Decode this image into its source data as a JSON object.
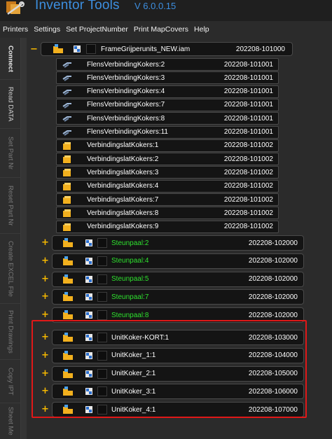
{
  "app": {
    "title": "Inventor Tools",
    "version": "V 6.0.0.15"
  },
  "menu": [
    "Printers",
    "Settings",
    "Set ProjectNumber",
    "Print MapCovers",
    "Help"
  ],
  "sidenav": [
    {
      "label": "Connect",
      "state": "active"
    },
    {
      "label": "Read DATA",
      "state": "mid"
    },
    {
      "label": "Set Part Nr",
      "state": "dim"
    },
    {
      "label": "Reset Part Nr",
      "state": "dim"
    },
    {
      "label": "Create EXCEL File",
      "state": "dim"
    },
    {
      "label": "Print Drawings",
      "state": "dim"
    },
    {
      "label": "Copy IPT",
      "state": "dim"
    },
    {
      "label": "Sheet Me",
      "state": "dim"
    }
  ],
  "tree": {
    "root": {
      "expander": "−",
      "label": "FrameGrijperunits_NEW.iam",
      "number": "202208-101000"
    },
    "children": [
      {
        "type": "flange",
        "label": "FlensVerbindingKokers:2",
        "number": "202208-101001"
      },
      {
        "type": "flange",
        "label": "FlensVerbindingKokers:3",
        "number": "202208-101001"
      },
      {
        "type": "flange",
        "label": "FlensVerbindingKokers:4",
        "number": "202208-101001"
      },
      {
        "type": "flange",
        "label": "FlensVerbindingKokers:7",
        "number": "202208-101001"
      },
      {
        "type": "flange",
        "label": "FlensVerbindingKokers:8",
        "number": "202208-101001"
      },
      {
        "type": "flange",
        "label": "FlensVerbindingKokers:11",
        "number": "202208-101001"
      },
      {
        "type": "part",
        "label": "VerbindingslatKokers:1",
        "number": "202208-101002"
      },
      {
        "type": "part",
        "label": "VerbindingslatKokers:2",
        "number": "202208-101002"
      },
      {
        "type": "part",
        "label": "VerbindingslatKokers:3",
        "number": "202208-101002"
      },
      {
        "type": "part",
        "label": "VerbindingslatKokers:4",
        "number": "202208-101002"
      },
      {
        "type": "part",
        "label": "VerbindingslatKokers:7",
        "number": "202208-101002"
      },
      {
        "type": "part",
        "label": "VerbindingslatKokers:8",
        "number": "202208-101002"
      },
      {
        "type": "part",
        "label": "VerbindingslatKokers:9",
        "number": "202208-101002"
      }
    ],
    "assemblies": [
      {
        "expander": "+",
        "label": "Steunpaal:2",
        "number": "202208-102000",
        "green": true
      },
      {
        "expander": "+",
        "label": "Steunpaal:4",
        "number": "202208-102000",
        "green": true
      },
      {
        "expander": "+",
        "label": "Steunpaal:5",
        "number": "202208-102000",
        "green": true
      },
      {
        "expander": "+",
        "label": "Steunpaal:7",
        "number": "202208-102000",
        "green": true
      },
      {
        "expander": "+",
        "label": "Steunpaal:8",
        "number": "202208-102000",
        "green": true
      },
      {
        "expander": "+",
        "label": "UnitKoker-KORT:1",
        "number": "202208-103000",
        "green": false
      },
      {
        "expander": "+",
        "label": "UnitKoker_1:1",
        "number": "202208-104000",
        "green": false
      },
      {
        "expander": "+",
        "label": "UnitKoker_2:1",
        "number": "202208-105000",
        "green": false
      },
      {
        "expander": "+",
        "label": "UnitKoker_3:1",
        "number": "202208-106000",
        "green": false
      },
      {
        "expander": "+",
        "label": "UnitKoker_4:1",
        "number": "202208-107000",
        "green": false
      }
    ]
  },
  "colors": {
    "accent": "#3d8fe0",
    "green_label": "#2ee02e",
    "expander": "#f5b800",
    "highlight": "#e01818"
  }
}
